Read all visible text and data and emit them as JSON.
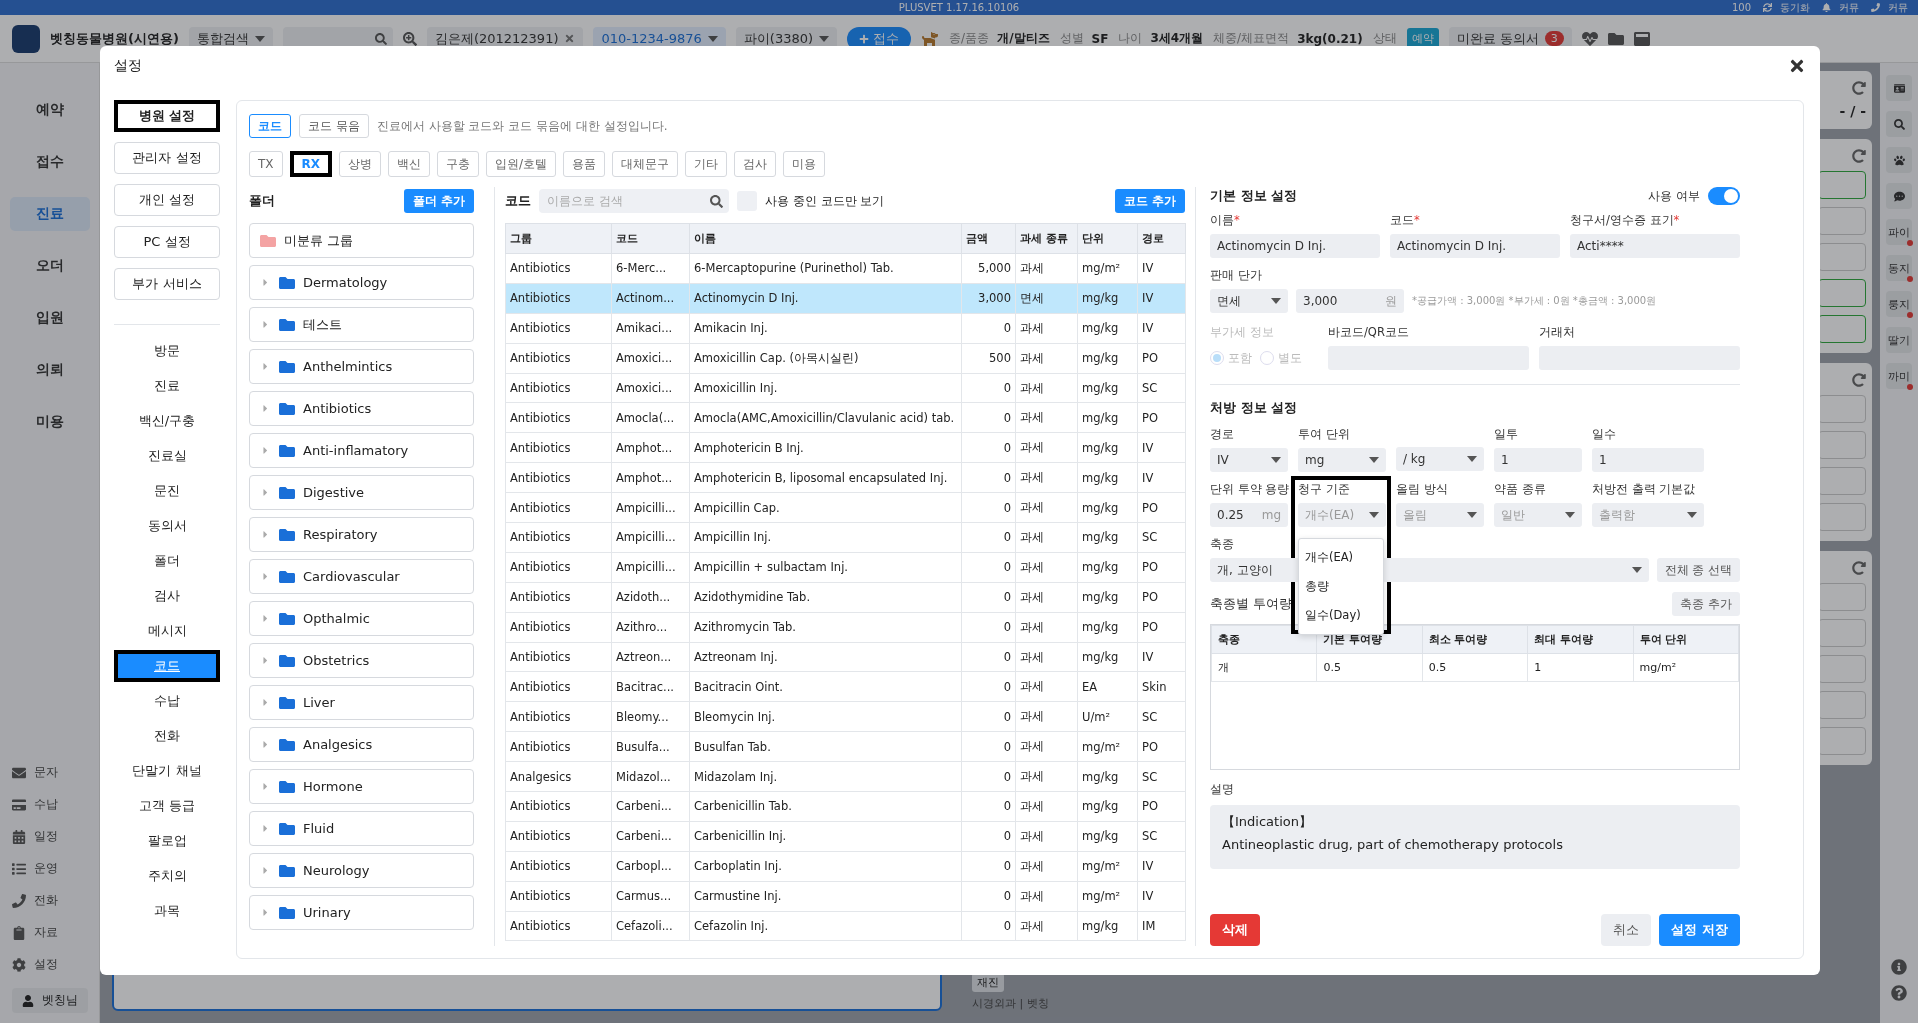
{
  "title_bar": {
    "app": "PLUSVET 1.17.16.10106",
    "zoom": "100",
    "actions": [
      "동기화",
      "커뮤",
      "커뮤"
    ]
  },
  "header": {
    "clinic": "벳칭동물병원(시연용)",
    "search_scope": "통합검색",
    "owner": "김은제(201212391)",
    "phone": "010-1234-9876",
    "patient": "파이(3380)",
    "register_button": "접수",
    "facts": [
      {
        "label": "종/품종",
        "value": "개/말티즈"
      },
      {
        "label": "성별",
        "value": "SF"
      },
      {
        "label": "나이",
        "value": "3세4개월"
      },
      {
        "label": "체중/체표면적",
        "value": "3kg(0.21)"
      }
    ],
    "status_label": "상태",
    "status": "예약",
    "consent": "미완료 동의서",
    "consent_count": "3"
  },
  "app_nav": {
    "items": [
      {
        "label": "예약",
        "selected": false
      },
      {
        "label": "접수",
        "selected": false
      },
      {
        "label": "진료",
        "selected": true
      },
      {
        "label": "오더",
        "selected": false
      },
      {
        "label": "입원",
        "selected": false
      },
      {
        "label": "의뢰",
        "selected": false
      },
      {
        "label": "미용",
        "selected": false
      }
    ],
    "tools": [
      "문자",
      "수납",
      "일정",
      "운영",
      "전화",
      "자료",
      "설정"
    ],
    "user": "벳칭님"
  },
  "right_rail": {
    "patients": [
      {
        "label": "파이",
        "alert": true
      },
      {
        "label": "동지",
        "alert": true
      },
      {
        "label": "룽지",
        "alert": true
      },
      {
        "label": "딸기",
        "alert": false
      },
      {
        "label": "까미",
        "alert": true
      }
    ]
  },
  "background": {
    "period": "- / -",
    "visit_badge": "재진",
    "visit_info": "시경외과 | 벳칭"
  },
  "dialog": {
    "title": "설정",
    "sections": [
      {
        "label": "병원 설정",
        "selected": true,
        "outlined": true
      },
      {
        "label": "관리자 설정",
        "selected": false,
        "outlined": false
      },
      {
        "label": "개인 설정",
        "selected": false,
        "outlined": false
      },
      {
        "label": "PC 설정",
        "selected": false,
        "outlined": false
      },
      {
        "label": "부가 서비스",
        "selected": false,
        "outlined": false
      }
    ],
    "menu": [
      {
        "label": "방문",
        "selected": false
      },
      {
        "label": "진료",
        "selected": false
      },
      {
        "label": "백신/구충",
        "selected": false
      },
      {
        "label": "진료실",
        "selected": false
      },
      {
        "label": "문진",
        "selected": false
      },
      {
        "label": "동의서",
        "selected": false
      },
      {
        "label": "폴더",
        "selected": false
      },
      {
        "label": "검사",
        "selected": false
      },
      {
        "label": "메시지",
        "selected": false
      },
      {
        "label": "코드",
        "selected": true
      },
      {
        "label": "수납",
        "selected": false
      },
      {
        "label": "전화",
        "selected": false
      },
      {
        "label": "단말기 채널",
        "selected": false
      },
      {
        "label": "고객 등급",
        "selected": false
      },
      {
        "label": "팔로업",
        "selected": false
      },
      {
        "label": "주치의",
        "selected": false
      },
      {
        "label": "과목",
        "selected": false
      }
    ],
    "tabs": [
      {
        "label": "코드",
        "selected": true
      },
      {
        "label": "코드 묶음",
        "selected": false
      }
    ],
    "tabs_description": "진료에서 사용할 코드와 코드 묶음에 대한 설정입니다.",
    "categories": [
      {
        "label": "TX",
        "selected": false
      },
      {
        "label": "RX",
        "selected": true
      },
      {
        "label": "상병",
        "selected": false
      },
      {
        "label": "백신",
        "selected": false
      },
      {
        "label": "구충",
        "selected": false
      },
      {
        "label": "입원/호텔",
        "selected": false
      },
      {
        "label": "용품",
        "selected": false
      },
      {
        "label": "대체문구",
        "selected": false
      },
      {
        "label": "기타",
        "selected": false
      },
      {
        "label": "검사",
        "selected": false
      },
      {
        "label": "미용",
        "selected": false
      }
    ],
    "folders": {
      "title": "폴더",
      "add_button": "폴더 추가",
      "items": [
        {
          "label": "미분류 그룹",
          "kind": "ungrouped"
        },
        {
          "label": "Dermatology",
          "kind": "folder"
        },
        {
          "label": "테스트",
          "kind": "folder"
        },
        {
          "label": "Anthelmintics",
          "kind": "folder"
        },
        {
          "label": "Antibiotics",
          "kind": "folder"
        },
        {
          "label": "Anti-inflamatory",
          "kind": "folder"
        },
        {
          "label": "Digestive",
          "kind": "folder"
        },
        {
          "label": "Respiratory",
          "kind": "folder"
        },
        {
          "label": "Cardiovascular",
          "kind": "folder"
        },
        {
          "label": "Opthalmic",
          "kind": "folder"
        },
        {
          "label": "Obstetrics",
          "kind": "folder"
        },
        {
          "label": "Liver",
          "kind": "folder"
        },
        {
          "label": "Analgesics",
          "kind": "folder"
        },
        {
          "label": "Hormone",
          "kind": "folder"
        },
        {
          "label": "Fluid",
          "kind": "folder"
        },
        {
          "label": "Neurology",
          "kind": "folder"
        },
        {
          "label": "Urinary",
          "kind": "folder"
        }
      ]
    },
    "codes": {
      "title": "코드",
      "search_placeholder": "이름으로 검색",
      "in_use_only": {
        "label": "사용 중인 코드만 보기",
        "checked": false
      },
      "add_button": "코드 추가",
      "columns": [
        "그룹",
        "코드",
        "이름",
        "금액",
        "과세 종류",
        "단위",
        "경로"
      ],
      "rows": [
        {
          "cells": [
            "Antibiotics",
            "6-Merc...",
            "6-Mercaptopurine (Purinethol) Tab.",
            "5,000",
            "과세",
            "mg/m²",
            "IV"
          ],
          "selected": false
        },
        {
          "cells": [
            "Antibiotics",
            "Actinom...",
            "Actinomycin D Inj.",
            "3,000",
            "면세",
            "mg/kg",
            "IV"
          ],
          "selected": true
        },
        {
          "cells": [
            "Antibiotics",
            "Amikaci...",
            "Amikacin Inj.",
            "0",
            "과세",
            "mg/kg",
            "IV"
          ],
          "selected": false
        },
        {
          "cells": [
            "Antibiotics",
            "Amoxici...",
            "Amoxicillin Cap. (아목시실린)",
            "500",
            "과세",
            "mg/kg",
            "PO"
          ],
          "selected": false
        },
        {
          "cells": [
            "Antibiotics",
            "Amoxici...",
            "Amoxicillin Inj.",
            "0",
            "과세",
            "mg/kg",
            "SC"
          ],
          "selected": false
        },
        {
          "cells": [
            "Antibiotics",
            "Amocla(...",
            "Amocla(AMC,Amoxicillin/Clavulanic acid) tab.",
            "0",
            "과세",
            "mg/kg",
            "PO"
          ],
          "selected": false
        },
        {
          "cells": [
            "Antibiotics",
            "Amphot...",
            "Amphotericin B Inj.",
            "0",
            "과세",
            "mg/kg",
            "IV"
          ],
          "selected": false
        },
        {
          "cells": [
            "Antibiotics",
            "Amphot...",
            "Amphotericin B, liposomal encapsulated Inj.",
            "0",
            "과세",
            "mg/kg",
            "IV"
          ],
          "selected": false
        },
        {
          "cells": [
            "Antibiotics",
            "Ampicilli...",
            "Ampicillin Cap.",
            "0",
            "과세",
            "mg/kg",
            "PO"
          ],
          "selected": false
        },
        {
          "cells": [
            "Antibiotics",
            "Ampicilli...",
            "Ampicillin Inj.",
            "0",
            "과세",
            "mg/kg",
            "SC"
          ],
          "selected": false
        },
        {
          "cells": [
            "Antibiotics",
            "Ampicilli...",
            "Ampicillin + sulbactam Inj.",
            "0",
            "과세",
            "mg/kg",
            "PO"
          ],
          "selected": false
        },
        {
          "cells": [
            "Antibiotics",
            "Azidoth...",
            "Azidothymidine Tab.",
            "0",
            "과세",
            "mg/kg",
            "PO"
          ],
          "selected": false
        },
        {
          "cells": [
            "Antibiotics",
            "Azithro...",
            "Azithromycin Tab.",
            "0",
            "과세",
            "mg/kg",
            "PO"
          ],
          "selected": false
        },
        {
          "cells": [
            "Antibiotics",
            "Aztreon...",
            "Aztreonam Inj.",
            "0",
            "과세",
            "mg/kg",
            "IV"
          ],
          "selected": false
        },
        {
          "cells": [
            "Antibiotics",
            "Bacitrac...",
            "Bacitracin Oint.",
            "0",
            "과세",
            "EA",
            "Skin"
          ],
          "selected": false
        },
        {
          "cells": [
            "Antibiotics",
            "Bleomy...",
            "Bleomycin Inj.",
            "0",
            "과세",
            "U/m²",
            "SC"
          ],
          "selected": false
        },
        {
          "cells": [
            "Antibiotics",
            "Busulfa...",
            "Busulfan Tab.",
            "0",
            "과세",
            "mg/m²",
            "PO"
          ],
          "selected": false
        },
        {
          "cells": [
            "Analgesics",
            "Midazol...",
            "Midazolam Inj.",
            "0",
            "과세",
            "mg/kg",
            "SC"
          ],
          "selected": false
        },
        {
          "cells": [
            "Antibiotics",
            "Carbeni...",
            "Carbenicillin Tab.",
            "0",
            "과세",
            "mg/kg",
            "PO"
          ],
          "selected": false
        },
        {
          "cells": [
            "Antibiotics",
            "Carbeni...",
            "Carbenicillin Inj.",
            "0",
            "과세",
            "mg/kg",
            "SC"
          ],
          "selected": false
        },
        {
          "cells": [
            "Antibiotics",
            "Carbopl...",
            "Carboplatin Inj.",
            "0",
            "과세",
            "mg/m²",
            "IV"
          ],
          "selected": false
        },
        {
          "cells": [
            "Antibiotics",
            "Carmus...",
            "Carmustine Inj.",
            "0",
            "과세",
            "mg/m²",
            "IV"
          ],
          "selected": false
        },
        {
          "cells": [
            "Antibiotics",
            "Cefazoli...",
            "Cefazolin Inj.",
            "0",
            "과세",
            "mg/kg",
            "IM"
          ],
          "selected": false
        }
      ]
    },
    "detail": {
      "basic_title": "기본 정보 설정",
      "required_mark": "*",
      "in_use": {
        "label": "사용 여부",
        "on": true
      },
      "basic_fields": [
        {
          "label": "이름",
          "required": true,
          "value": "Actinomycin D Inj."
        },
        {
          "label": "코드",
          "required": true,
          "value": "Actinomycin D Inj."
        },
        {
          "label": "청구서/영수증 표기",
          "required": true,
          "value": "Acti****"
        }
      ],
      "price": {
        "label": "판매 단가",
        "tax": "면세",
        "amount": "3,000",
        "unit": "원",
        "note": "*공급가액 : 3,000원 *부가세 : 0원 *총금액 : 3,000원"
      },
      "vat": {
        "label": "부가세 정보",
        "disabled": true,
        "options": [
          {
            "label": "포함",
            "selected": true
          },
          {
            "label": "별도",
            "selected": false
          }
        ]
      },
      "barcode_label": "바코드/QR코드",
      "vendor_label": "거래처",
      "rx_title": "처방 정보 설정",
      "rx_rows": [
        [
          {
            "label": "경로",
            "kind": "select",
            "value": "IV"
          },
          {
            "label": "투여 단위",
            "kind": "select",
            "value": "mg"
          },
          {
            "kind": "select",
            "value": "/ kg"
          },
          {
            "label": "일투",
            "kind": "input",
            "value": "1"
          },
          {
            "label": "일수",
            "kind": "input",
            "value": "1"
          }
        ],
        [
          {
            "label": "단위 투약 용량",
            "kind": "unit_input",
            "value": "0.25",
            "unit": "mg"
          },
          {
            "label": "청구 기준",
            "kind": "select",
            "value": "개수(EA)",
            "open": true,
            "options": [
              "개수(EA)",
              "총량",
              "일수(Day)"
            ]
          },
          {
            "label": "올림 방식",
            "kind": "select",
            "value": "올림"
          },
          {
            "label": "약품 종류",
            "kind": "select",
            "value": "일반"
          },
          {
            "label": "처방전 출력 기본값",
            "kind": "select",
            "value": "출력함"
          }
        ]
      ],
      "species": {
        "label": "축종",
        "value": "개, 고양이",
        "button": "전체 종 선택"
      },
      "doses": {
        "label": "축종별 투여량",
        "button": "축종 추가",
        "columns": [
          "축종",
          "기본 투여량",
          "최소 투여량",
          "최대 투여량",
          "투여 단위"
        ],
        "rows": [
          [
            "개",
            "0.5",
            "0.5",
            "1",
            "mg/m²"
          ]
        ]
      },
      "description": {
        "label": "설명",
        "lines": [
          "【Indication】",
          "Antineoplastic drug, part of chemotherapy protocols"
        ]
      },
      "delete_button": "삭제",
      "cancel_button": "취소",
      "save_button": "설정 저장"
    }
  }
}
